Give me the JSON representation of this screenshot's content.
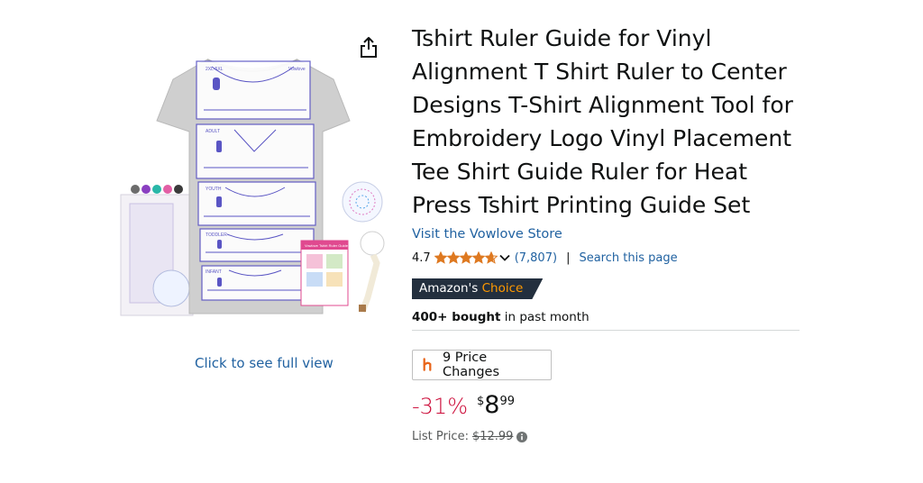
{
  "product": {
    "title": "Tshirt Ruler Guide for Vinyl Alignment T Shirt Ruler to Center Designs T-Shirt Alignment Tool for Embroidery Logo Vinyl Placement Tee Shirt Guide Ruler for Heat Press Tshirt Printing Guide Set",
    "store_link": "Visit the Vowlove Store",
    "rating": "4.7",
    "stars_value": 4.7,
    "review_count": "(7,807)",
    "rating_separator": "|",
    "search_page": "Search this page",
    "badge": {
      "prefix": "Amazon's",
      "highlight": "Choice"
    },
    "bought": {
      "bold": "400+ bought",
      "rest": " in past month"
    },
    "price_changes": "9 Price Changes",
    "discount": "-31%",
    "price": {
      "currency": "$",
      "whole": "8",
      "fraction": "99"
    },
    "list_price": {
      "label": "List Price:",
      "value": "$12.99"
    }
  },
  "gallery": {
    "see_full_view": "Click to see full view",
    "ruler_labels": [
      "2XL-5XL",
      "ADULT",
      "YOUTH",
      "TODDLER",
      "INFANT"
    ],
    "ruler_brand": "Vowlove",
    "card_title": "Vowlove Tshirt Ruler Guide"
  },
  "icons": {
    "share": "share-icon",
    "star": "star-icon",
    "chevron": "chevron-down-icon",
    "price_tracker": "price-tracker-icon",
    "info": "info-icon"
  },
  "colors": {
    "link": "#2162a1",
    "discount": "#cc0c39",
    "badge_bg": "#232f3e",
    "badge_accent": "#ff9900",
    "star": "#de7921",
    "ruler": "#5a55c4"
  }
}
